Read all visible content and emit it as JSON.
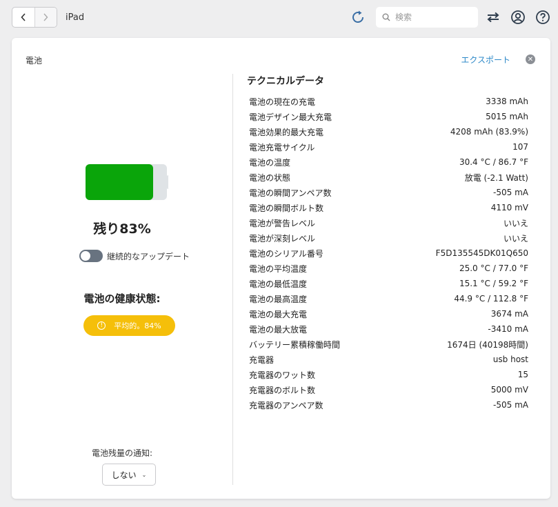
{
  "topbar": {
    "back_icon": "chevron-left",
    "forward_icon": "chevron-right",
    "device_name": "iPad",
    "search_placeholder": "検索"
  },
  "panel": {
    "title": "電池",
    "export_label": "エクスポート"
  },
  "battery": {
    "level_fraction": 0.83,
    "remaining_text": "残り83%",
    "fill_color": "#0aa50a",
    "continuous_update_label": "継続的なアップデート",
    "continuous_update_on": false,
    "health_title": "電池の健康状態:",
    "health_badge": "平均的。84%",
    "health_color": "#f5bf0a",
    "notify_label": "電池残量の通知:",
    "notify_value": "しない"
  },
  "tech": {
    "title": "テクニカルデータ",
    "rows": [
      {
        "label": "電池の現在の充電",
        "value": "3338 mAh"
      },
      {
        "label": "電池デザイン最大充電",
        "value": "5015 mAh"
      },
      {
        "label": "電池効果的最大充電",
        "value": "4208 mAh (83.9%)"
      },
      {
        "label": "電池充電サイクル",
        "value": "107"
      },
      {
        "label": "電池の温度",
        "value": "30.4 °C / 86.7 °F"
      },
      {
        "label": "電池の状態",
        "value": "放電 (-2.1 Watt)"
      },
      {
        "label": "電池の瞬間アンペア数",
        "value": "-505 mA"
      },
      {
        "label": "電池の瞬間ボルト数",
        "value": "4110 mV"
      },
      {
        "label": "電池が警告レベル",
        "value": "いいえ"
      },
      {
        "label": "電池が深刻レベル",
        "value": "いいえ"
      },
      {
        "label": "電池のシリアル番号",
        "value": "F5D135545DK01Q650"
      },
      {
        "label": "電池の平均温度",
        "value": "25.0 °C / 77.0 °F"
      },
      {
        "label": "電池の最低温度",
        "value": "15.1 °C / 59.2 °F"
      },
      {
        "label": "電池の最高温度",
        "value": "44.9 °C / 112.8 °F"
      },
      {
        "label": "電池の最大充電",
        "value": "3674 mA"
      },
      {
        "label": "電池の最大放電",
        "value": "-3410 mA"
      },
      {
        "label": "バッテリー累積稼働時間",
        "value": "1674日 (40198時間)"
      },
      {
        "label": "充電器",
        "value": "usb host"
      },
      {
        "label": "充電器のワット数",
        "value": "15"
      },
      {
        "label": "充電器のボルト数",
        "value": "5000 mV"
      },
      {
        "label": "充電器のアンペア数",
        "value": "-505 mA"
      }
    ]
  }
}
